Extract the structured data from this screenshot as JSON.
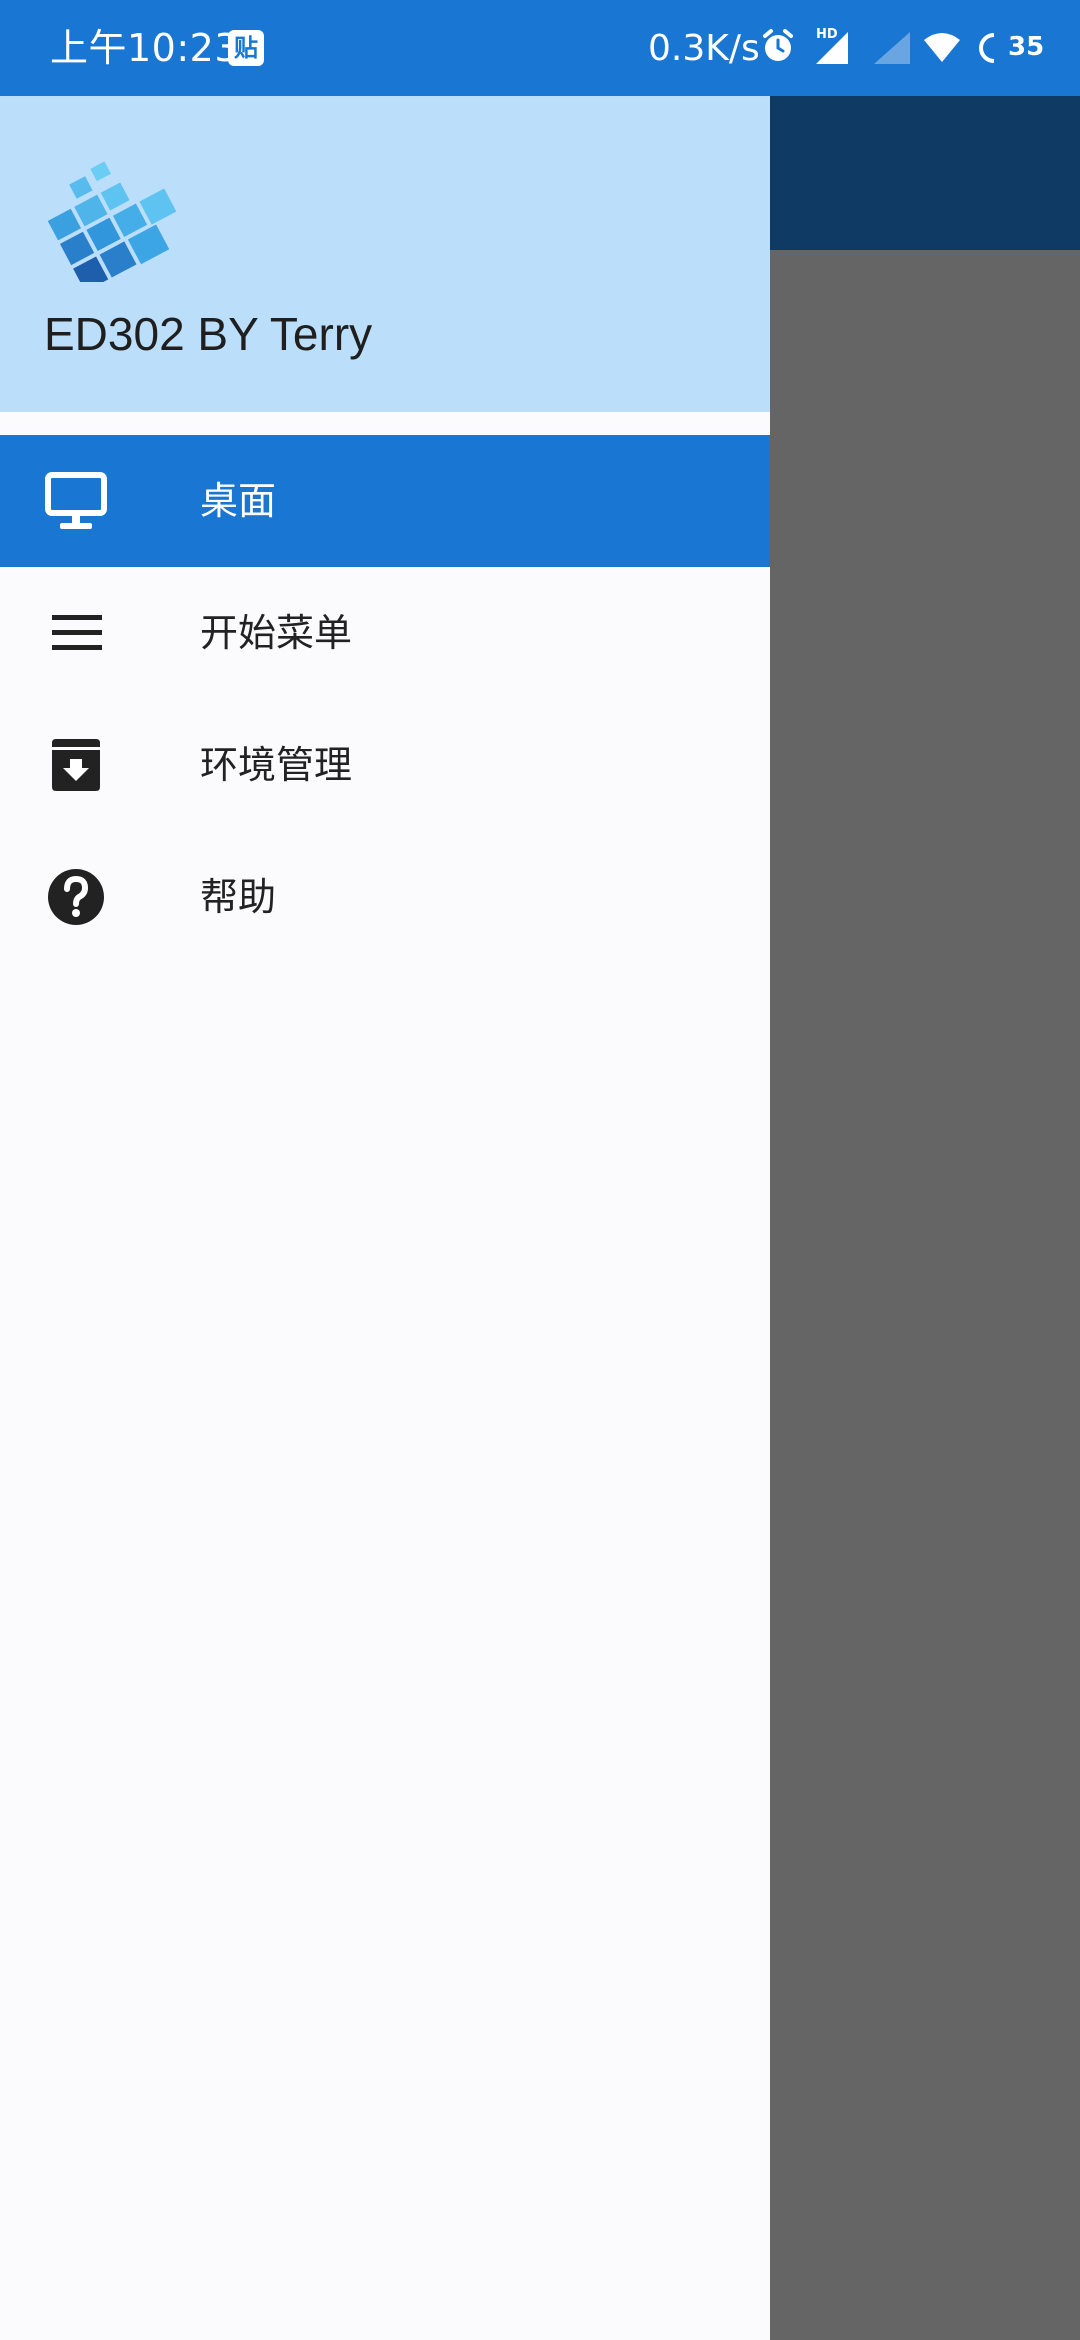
{
  "status_bar": {
    "time": "上午10:23",
    "notification_badge": "贴",
    "net_speed": "0.3K/s",
    "network_label": "HD",
    "battery": "35",
    "icons": [
      "alarm-icon",
      "hd-signal-icon",
      "signal-icon",
      "wifi-icon",
      "battery-icon"
    ]
  },
  "drawer": {
    "app_title": "ED302 BY Terry",
    "logo_icon": "app-logo-icon",
    "items": [
      {
        "label": "桌面",
        "icon": "monitor-icon",
        "active": true
      },
      {
        "label": "开始菜单",
        "icon": "menu-lines-icon",
        "active": false
      },
      {
        "label": "环境管理",
        "icon": "archive-download-icon",
        "active": false
      },
      {
        "label": "帮助",
        "icon": "help-circle-icon",
        "active": false
      }
    ]
  },
  "colors": {
    "status_bar": "#1976d2",
    "header": "#bbdefb",
    "active_item": "#1976d2",
    "scrim": "#666566",
    "background_appbar": "#0e3a63"
  }
}
